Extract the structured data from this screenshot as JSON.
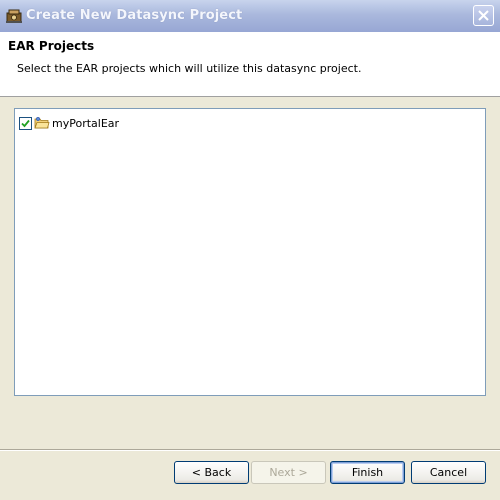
{
  "window": {
    "title": "Create New Datasync Project",
    "colors": {
      "titlebar": "#aab8dd",
      "title_text": "#f4f6fc",
      "dialog_bg": "#ece9d8"
    }
  },
  "header": {
    "title": "EAR Projects",
    "description": "Select the EAR projects which will utilize this datasync project."
  },
  "tree": {
    "items": [
      {
        "label": "myPortalEar",
        "checked": true,
        "icon": "ear-project-icon"
      }
    ]
  },
  "buttons": {
    "back": "< Back",
    "next": "Next >",
    "finish": "Finish",
    "cancel": "Cancel"
  }
}
